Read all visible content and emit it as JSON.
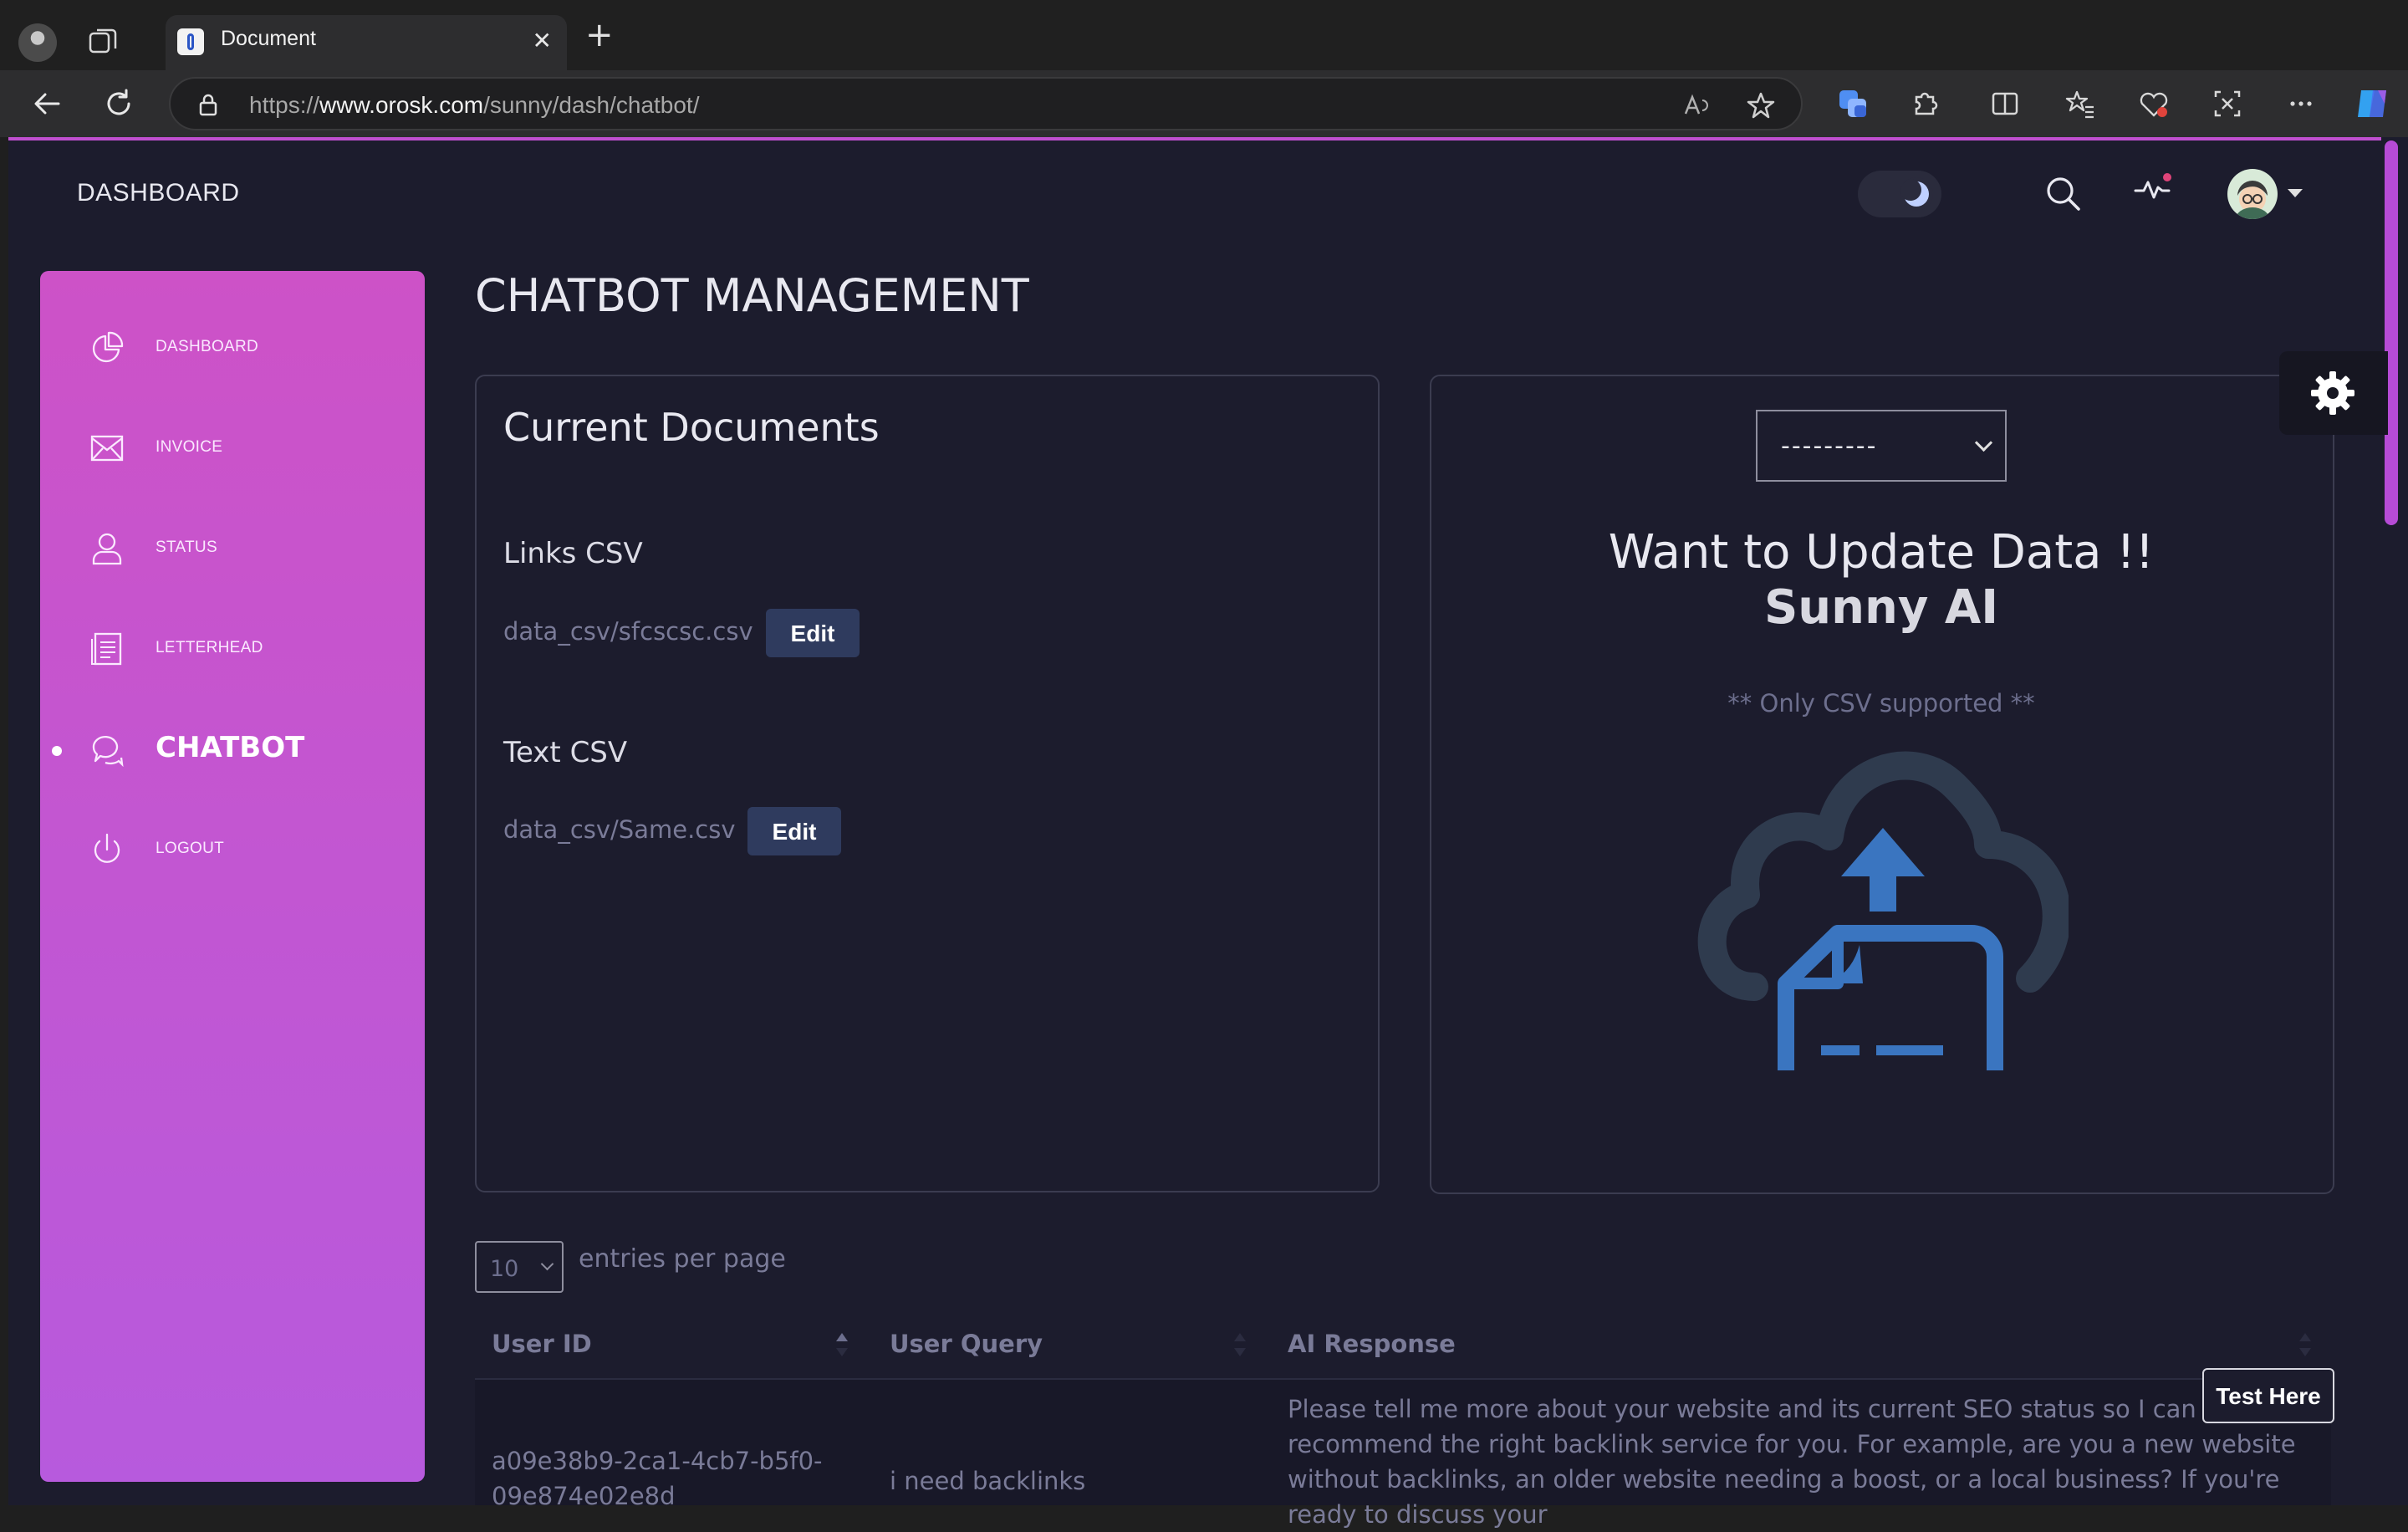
{
  "browser": {
    "tab_title": "Document",
    "tab_close": "✕",
    "new_tab": "+",
    "url_prefix": "https://",
    "url_domain": "www.orosk.com",
    "url_path": "/sunny/dash/chatbot/"
  },
  "header": {
    "brand": "DASHBOARD",
    "theme_toggle": "dark"
  },
  "sidebar": {
    "items": [
      {
        "label": "DASHBOARD",
        "icon": "pie-chart-icon"
      },
      {
        "label": "INVOICE",
        "icon": "envelope-icon"
      },
      {
        "label": "STATUS",
        "icon": "user-icon"
      },
      {
        "label": "LETTERHEAD",
        "icon": "document-icon"
      },
      {
        "label": "CHATBOT",
        "icon": "chat-icon",
        "active": true
      },
      {
        "label": "LOGOUT",
        "icon": "power-icon"
      }
    ]
  },
  "main": {
    "title": "CHATBOT MANAGEMENT",
    "documents": {
      "title": "Current Documents",
      "links": {
        "heading": "Links CSV",
        "file": "data_csv/sfcscsc.csv",
        "button": "Edit"
      },
      "text": {
        "heading": "Text CSV",
        "file": "data_csv/Same.csv",
        "button": "Edit"
      }
    },
    "upload": {
      "select_value": "---------",
      "title": "Want to Update Data !!",
      "brand": "Sunny AI",
      "note": "** Only CSV supported **"
    },
    "table": {
      "entries_value": "10",
      "entries_label": "entries per page",
      "columns": [
        "User ID",
        "User Query",
        "AI Response"
      ],
      "rows": [
        {
          "user_id": "a09e38b9-2ca1-4cb7-b5f0-09e874e02e8d",
          "query": "i need backlinks",
          "response": "Please tell me more about your website and its current SEO status so I can recommend the right backlink service for you. For example, are you a new website without backlinks, an older website needing a boost, or a local business? If you're ready to discuss your"
        }
      ]
    },
    "test_button": "Test Here"
  },
  "colors": {
    "page_bg": "#1c1c2d",
    "sidebar_top": "#cd52c7",
    "sidebar_bottom": "#b75add",
    "edit_button": "#2f3b5e",
    "cloud_dark": "#2f3b4e",
    "cloud_accent": "#3a75c0"
  }
}
